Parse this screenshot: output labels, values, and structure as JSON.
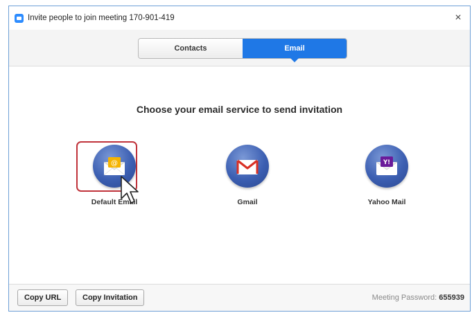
{
  "window": {
    "title": "Invite people to join meeting 170-901-419",
    "close_glyph": "×"
  },
  "tabs": [
    {
      "label": "Contacts",
      "active": false
    },
    {
      "label": "Email",
      "active": true
    }
  ],
  "main": {
    "heading": "Choose your email service to send invitation",
    "services": [
      {
        "label": "Default Email",
        "icon": "envelope-at-icon",
        "selected": true
      },
      {
        "label": "Gmail",
        "icon": "gmail-icon",
        "selected": false
      },
      {
        "label": "Yahoo Mail",
        "icon": "yahoo-mail-icon",
        "selected": false
      }
    ]
  },
  "footer": {
    "copy_url_label": "Copy URL",
    "copy_invitation_label": "Copy Invitation",
    "password_label": "Meeting Password:",
    "password_value": "655939"
  },
  "colors": {
    "accent": "#1f78e6",
    "highlight": "#c0323a",
    "service_circle": "#3c5fb2"
  }
}
